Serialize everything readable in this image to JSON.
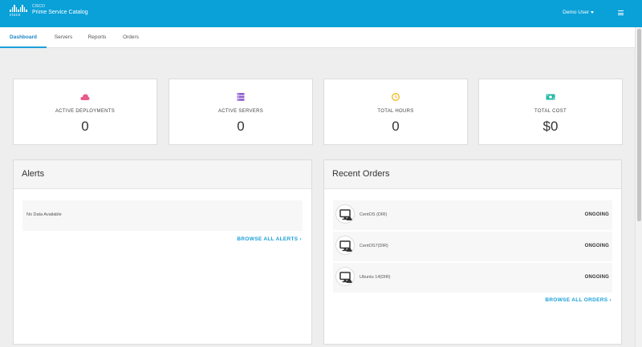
{
  "header": {
    "brand_small": "CISCO",
    "brand_title": "Prime Service Catalog",
    "logo_word": "cisco",
    "user": "Demo User",
    "accent": "#0aa0d8"
  },
  "tabs": [
    {
      "label": "Dashboard",
      "active": true
    },
    {
      "label": "Servers"
    },
    {
      "label": "Reports"
    },
    {
      "label": "Orders"
    }
  ],
  "stats": [
    {
      "label": "ACTIVE DEPLOYMENTS",
      "value": "0",
      "icon": "cloud-icon",
      "color": "#e85b8a"
    },
    {
      "label": "ACTIVE SERVERS",
      "value": "0",
      "icon": "server-stack-icon",
      "color": "#8d5ccf"
    },
    {
      "label": "TOTAL HOURS",
      "value": "0",
      "icon": "clock-icon",
      "color": "#f2b820"
    },
    {
      "label": "TOTAL COST",
      "value": "$0",
      "icon": "money-icon",
      "color": "#26b8a6"
    }
  ],
  "alerts": {
    "title": "Alerts",
    "empty_text": "No Data Available",
    "browse_label": "BROWSE ALL ALERTS"
  },
  "recent_orders": {
    "title": "Recent Orders",
    "items": [
      {
        "name": "CentOS (DIR)",
        "status": "ONGOING",
        "icon": "desktop-cloud-icon"
      },
      {
        "name": "CentOS7(DIR)",
        "status": "ONGOING",
        "icon": "desktop-cloud-icon"
      },
      {
        "name": "Ubuntu 14(DIR)",
        "status": "ONGOING",
        "icon": "desktop-cloud-icon"
      }
    ],
    "browse_label": "BROWSE ALL ORDERS"
  }
}
